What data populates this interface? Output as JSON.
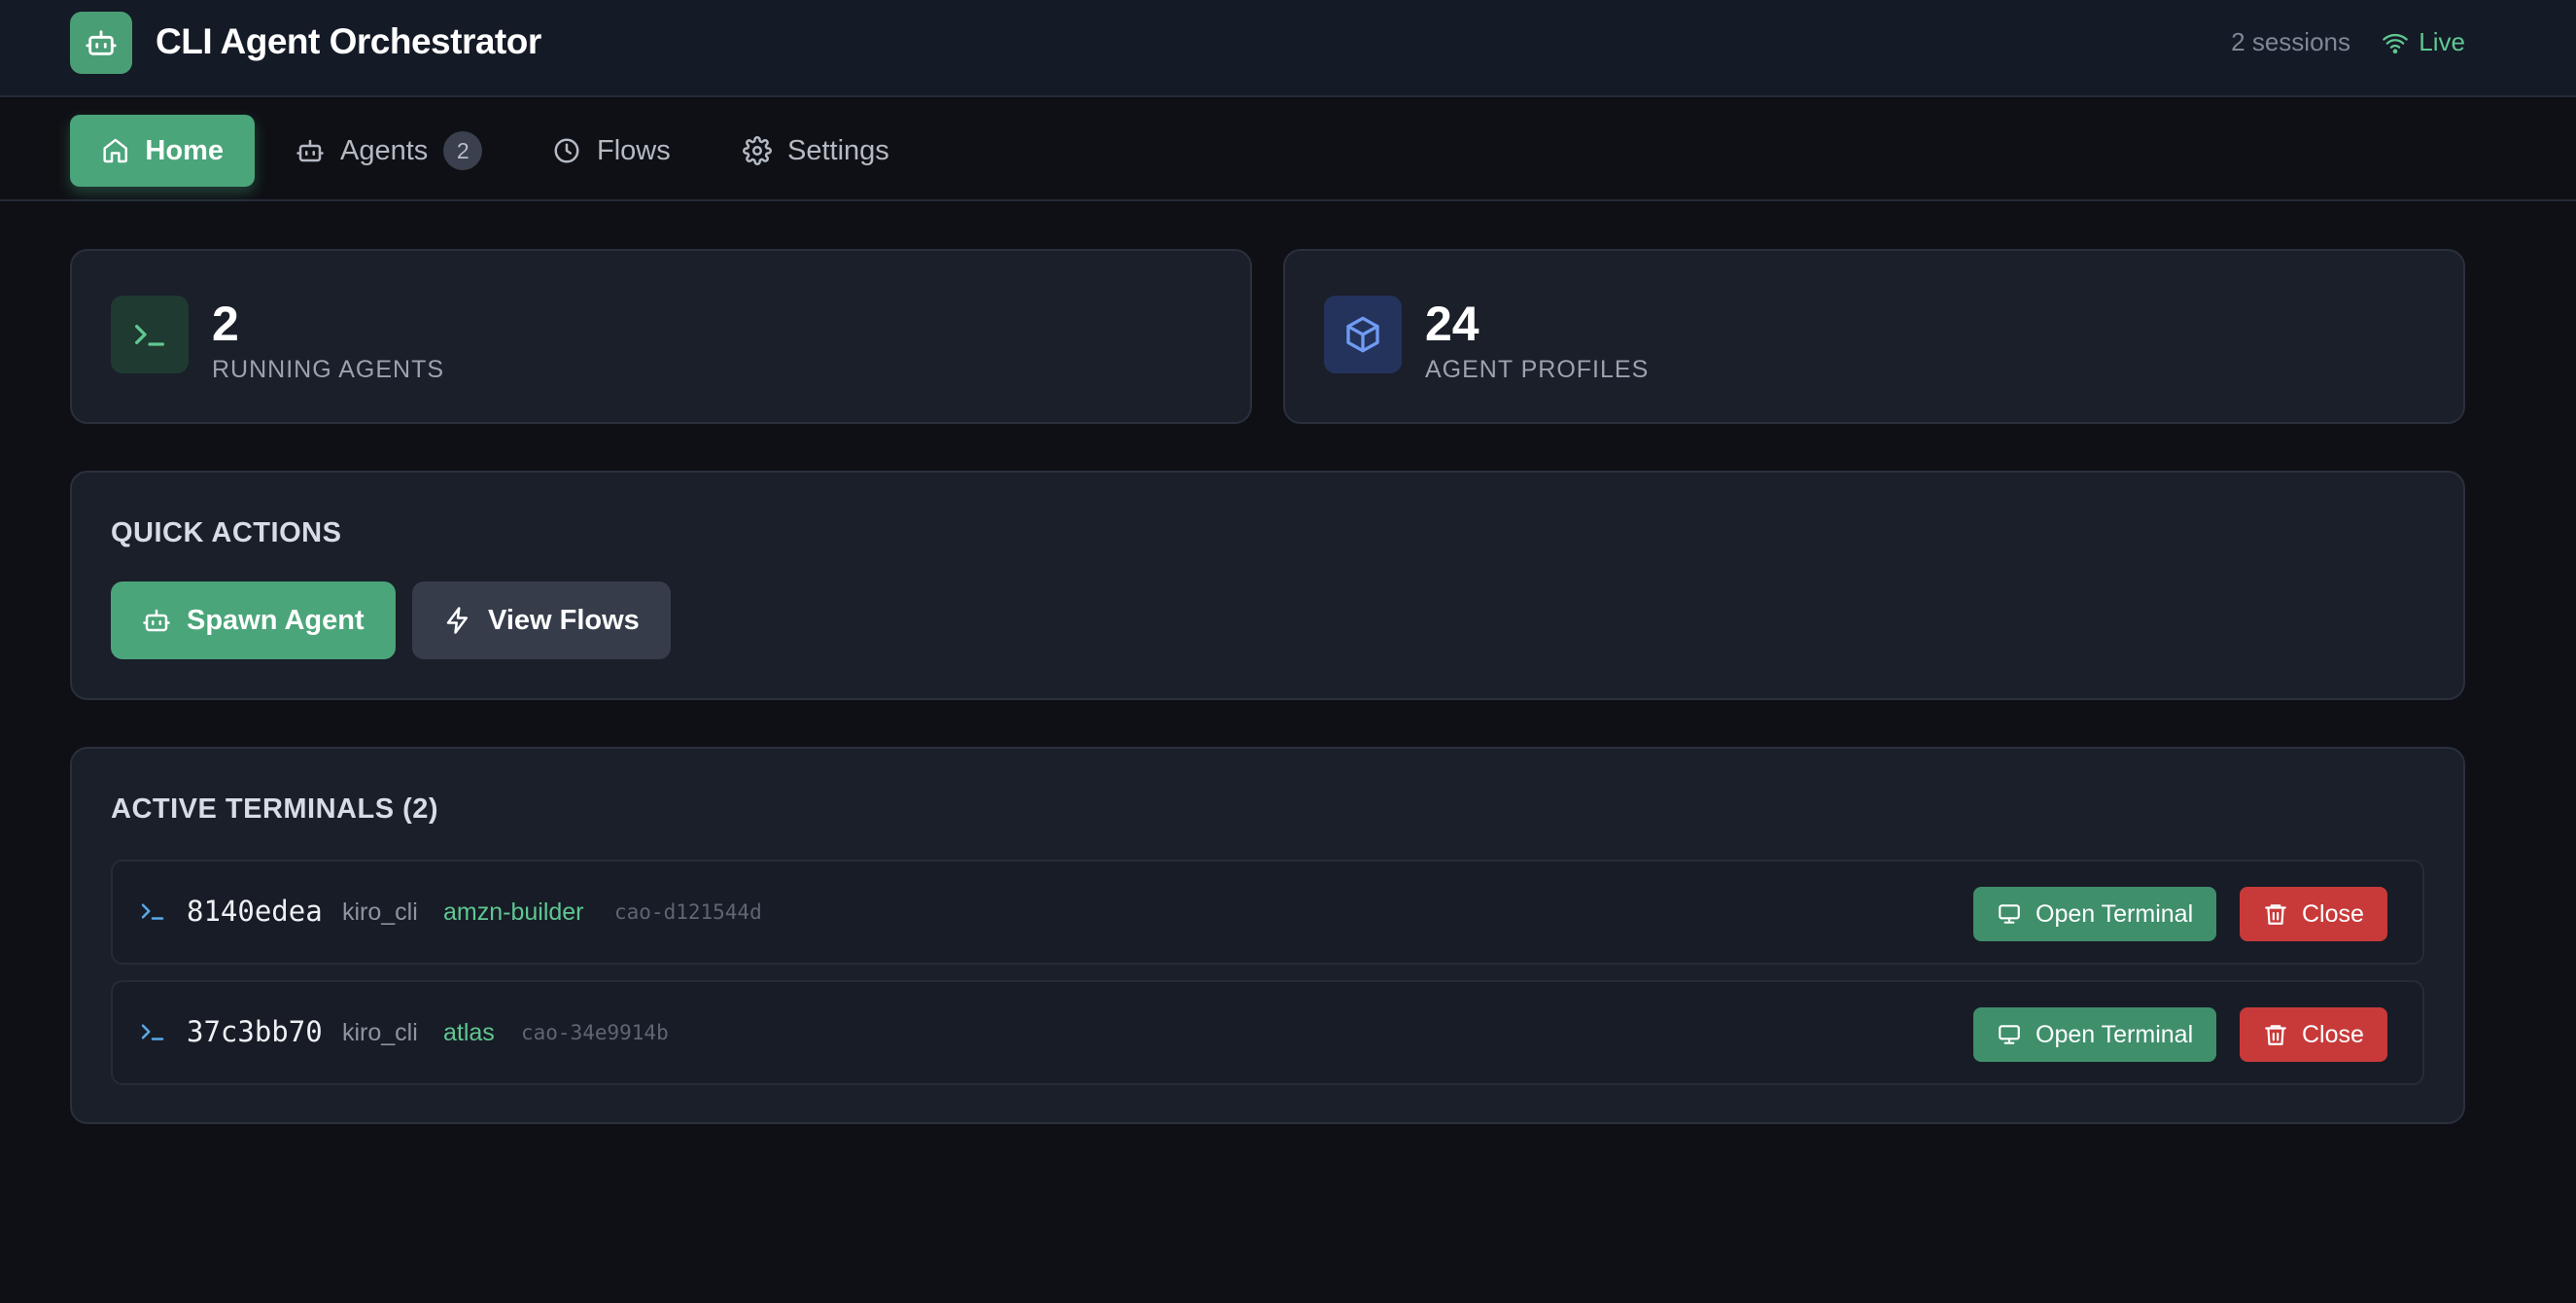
{
  "header": {
    "title": "CLI Agent Orchestrator",
    "sessions": "2 sessions",
    "status": "Live",
    "status_color": "#5fc792"
  },
  "nav": {
    "home": "Home",
    "agents": "Agents",
    "agents_count": "2",
    "flows": "Flows",
    "settings": "Settings"
  },
  "stats": {
    "running": {
      "value": "2",
      "label": "RUNNING AGENTS",
      "icon": "terminal-prompt-icon"
    },
    "profiles": {
      "value": "24",
      "label": "AGENT PROFILES",
      "icon": "cube-icon"
    }
  },
  "quick_actions": {
    "title": "QUICK ACTIONS",
    "spawn": "Spawn Agent",
    "view_flows": "View Flows"
  },
  "terminals": {
    "title": "ACTIVE TERMINALS (2)",
    "open_label": "Open Terminal",
    "close_label": "Close",
    "rows": [
      {
        "id": "8140edea",
        "provider": "kiro_cli",
        "profile": "amzn-builder",
        "session": "cao-d121544d"
      },
      {
        "id": "37c3bb70",
        "provider": "kiro_cli",
        "profile": "atlas",
        "session": "cao-34e9914b"
      }
    ]
  },
  "colors": {
    "accent": "#4aa57a",
    "danger": "#c83a3a",
    "background": "#0f1015"
  }
}
